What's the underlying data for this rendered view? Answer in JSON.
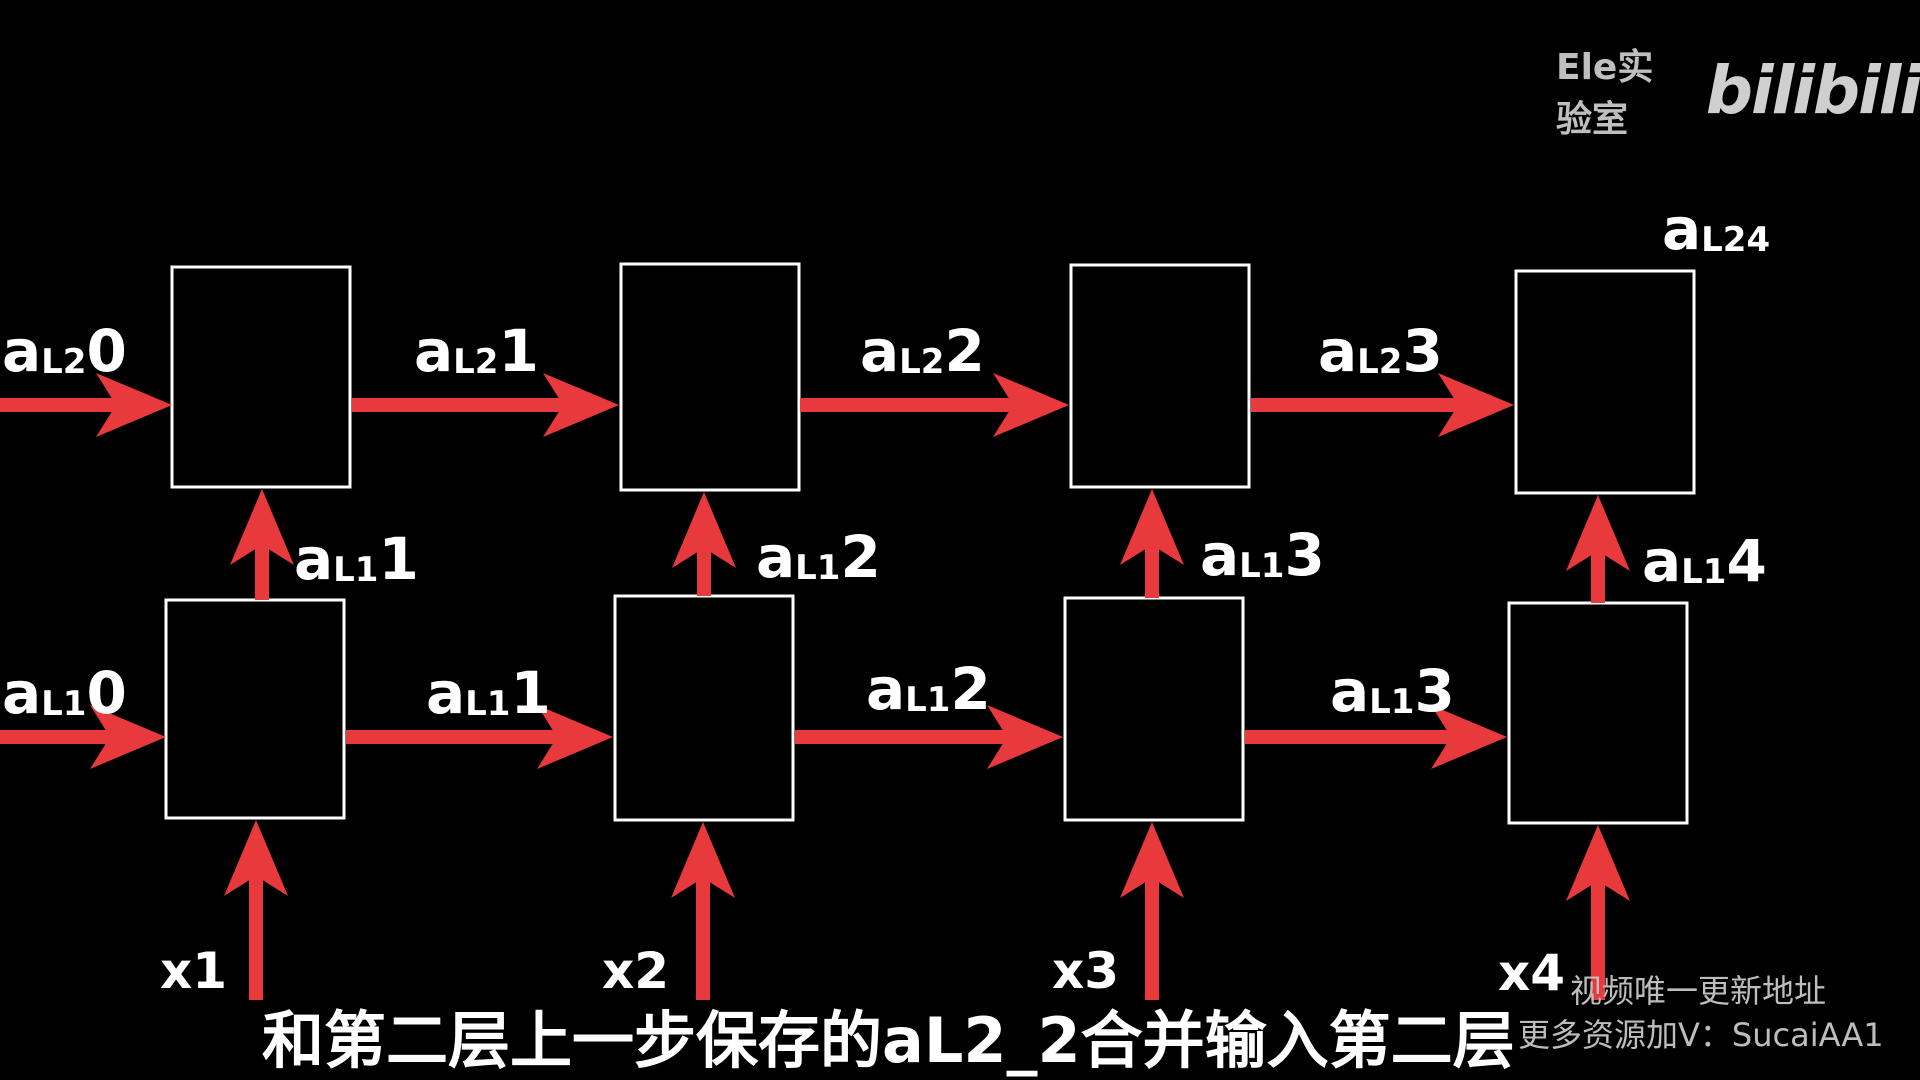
{
  "colors": {
    "background": "#000000",
    "arrow": "#e8393d",
    "box_stroke": "#ffffff",
    "text": "#ffffff"
  },
  "watermark": {
    "channel": "Ele实验室",
    "logo": "bilibili"
  },
  "labels": {
    "l2_h0": {
      "base": "a",
      "sub": "L2",
      "idx": "0"
    },
    "l2_h1": {
      "base": "a",
      "sub": "L2",
      "idx": "1"
    },
    "l2_h2": {
      "base": "a",
      "sub": "L2",
      "idx": "2"
    },
    "l2_h3": {
      "base": "a",
      "sub": "L2",
      "idx": "3"
    },
    "l2_out4": {
      "base": "a",
      "sub": "L24",
      "idx": ""
    },
    "l1_up1": {
      "base": "a",
      "sub": "L1",
      "idx": "1"
    },
    "l1_up2": {
      "base": "a",
      "sub": "L1",
      "idx": "2"
    },
    "l1_up3": {
      "base": "a",
      "sub": "L1",
      "idx": "3"
    },
    "l1_up4": {
      "base": "a",
      "sub": "L1",
      "idx": "4"
    },
    "l1_h0": {
      "base": "a",
      "sub": "L1",
      "idx": "0"
    },
    "l1_h1": {
      "base": "a",
      "sub": "L1",
      "idx": "1"
    },
    "l1_h2": {
      "base": "a",
      "sub": "L1",
      "idx": "2"
    },
    "l1_h3": {
      "base": "a",
      "sub": "L1",
      "idx": "3"
    }
  },
  "inputs": [
    "x1",
    "x2",
    "x3",
    "x4"
  ],
  "subtitle": "和第二层上一步保存的aL2_2合并输入第二层",
  "overlay_notes": {
    "line1": "视频唯一更新地址",
    "line2": "更多资源加V：SucaiAA1"
  }
}
